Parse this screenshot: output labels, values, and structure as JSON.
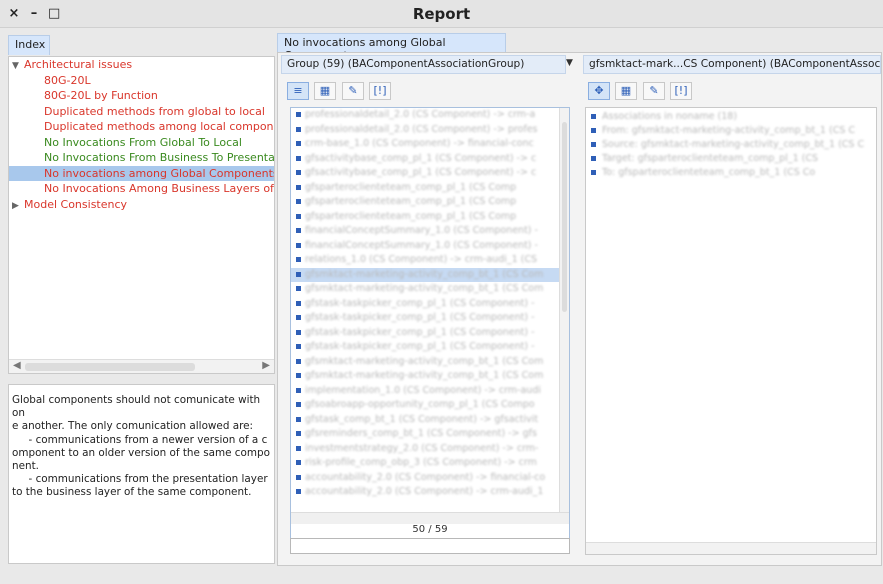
{
  "window": {
    "title": "Report",
    "controls": [
      "×",
      "–",
      "□"
    ]
  },
  "index": {
    "tab_label": "Index",
    "tree": [
      {
        "label": "Architectural issues",
        "level": 0,
        "expanded": true,
        "color": "red"
      },
      {
        "label": "80G-20L",
        "level": 1,
        "color": "red"
      },
      {
        "label": "80G-20L by Function",
        "level": 1,
        "color": "red"
      },
      {
        "label": "Duplicated methods from global to local",
        "level": 1,
        "color": "red"
      },
      {
        "label": "Duplicated methods among local componen",
        "level": 1,
        "color": "red"
      },
      {
        "label": "No Invocations From Global To Local",
        "level": 1,
        "color": "green"
      },
      {
        "label": "No Invocations From Business To Presentati",
        "level": 1,
        "color": "green"
      },
      {
        "label": "No invocations among Global Components",
        "level": 1,
        "color": "red",
        "selected": true
      },
      {
        "label": "No Invocations Among Business Layers of D",
        "level": 1,
        "color": "red"
      },
      {
        "label": "Model Consistency",
        "level": 0,
        "expanded": false,
        "color": "red"
      }
    ],
    "description": "Global components should not comunicate with on\ne another. The only comunication allowed are:\n     - communications from a newer version of a c\nomponent to an older version of the same compo\nnent.\n     - communications from the presentation layer\nto the business layer of the same component."
  },
  "main": {
    "tab_label": "No invocations among Global Components",
    "group_tab": "Group (59) (BAComponentAssociationGroup)",
    "detail_tab": "gfsmktact-mark...CS Component) (BAComponentAssocia",
    "list_footer": "50 / 59",
    "list_items": [
      "professionaldetail_2.0 (CS Component) -> crm-a",
      "professionaldetail_2.0 (CS Component) -> profes",
      "crm-base_1.0 (CS Component) -> financial-conc",
      "gfsactivitybase_comp_pl_1 (CS Component) -> c",
      "gfsactivitybase_comp_pl_1 (CS Component) -> c",
      "gfsparteroclienteteam_comp_pl_1 (CS Comp",
      "gfsparteroclienteteam_comp_pl_1 (CS Comp",
      "gfsparteroclienteteam_comp_pl_1 (CS Comp",
      "financialConceptSummary_1.0 (CS Component) -",
      "financialConceptSummary_1.0 (CS Component) -",
      "relations_1.0 (CS Component) -> crm-audi_1 (CS",
      "gfsmktact-marketing-activity_comp_bt_1 (CS Com",
      "gfsmktact-marketing-activity_comp_bt_1 (CS Com",
      "gfstask-taskpicker_comp_pl_1 (CS Component) -",
      "gfstask-taskpicker_comp_pl_1 (CS Component) -",
      "gfstask-taskpicker_comp_pl_1 (CS Component) -",
      "gfstask-taskpicker_comp_pl_1 (CS Component) -",
      "gfsmktact-marketing-activity_comp_bt_1 (CS Com",
      "gfsmktact-marketing-activity_comp_bt_1 (CS Com",
      "implementation_1.0 (CS Component) -> crm-audi",
      "gfsoabroapp-opportunity_comp_pl_1 (CS Compo",
      "gfstask_comp_bt_1 (CS Component) -> gfsactivit",
      "gfsreminders_comp_bt_1 (CS Component) -> gfs",
      "investmentstrategy_2.0 (CS Component) -> crm-",
      "risk-profile_comp_obp_3 (CS Component) -> crm",
      "accountability_2.0 (CS Component) -> financial-co",
      "accountability_2.0 (CS Component) -> crm-audi_1"
    ],
    "selected_index": 11,
    "detail_items": [
      "Associations in noname (18)",
      "From: gfsmktact-marketing-activity_comp_bt_1 (CS C",
      "Source: gfsmktact-marketing-activity_comp_bt_1 (CS C",
      "Target: gfsparteroclienteteam_comp_pl_1 (CS",
      "To: gfsparteroclienteteam_comp_bt_1 (CS Co"
    ],
    "filter_placeholder": ""
  }
}
